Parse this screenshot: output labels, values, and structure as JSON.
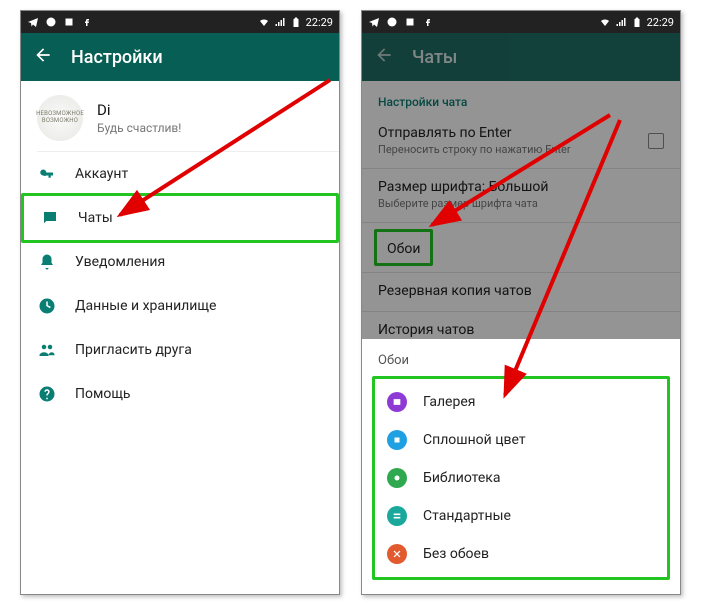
{
  "statusbar": {
    "time": "22:29"
  },
  "left": {
    "title": "Настройки",
    "profile": {
      "avatar_text": "НЕВОЗМОЖНОЕ ВОЗМОЖНО",
      "name": "Di",
      "status": "Будь счастлив!"
    },
    "items": [
      {
        "key": "account",
        "label": "Аккаунт"
      },
      {
        "key": "chats",
        "label": "Чаты"
      },
      {
        "key": "notif",
        "label": "Уведомления"
      },
      {
        "key": "data",
        "label": "Данные и хранилище"
      },
      {
        "key": "invite",
        "label": "Пригласить друга"
      },
      {
        "key": "help",
        "label": "Помощь"
      }
    ]
  },
  "right": {
    "title": "Чаты",
    "section": "Настройки чата",
    "settings": {
      "enter_send": {
        "title": "Отправлять по Enter",
        "sub": "Переносить строку по нажатию Enter"
      },
      "font": {
        "title": "Размер шрифта: Большой",
        "sub": "Выберите размер шрифта чата"
      },
      "wallpaper": {
        "title": "Обои"
      },
      "backup": {
        "title": "Резервная копия чатов"
      },
      "history": {
        "title": "История чатов"
      }
    },
    "sheet": {
      "title": "Обои",
      "items": [
        {
          "label": "Галерея"
        },
        {
          "label": "Сплошной цвет"
        },
        {
          "label": "Библиотека"
        },
        {
          "label": "Стандартные"
        },
        {
          "label": "Без обоев"
        }
      ]
    }
  }
}
